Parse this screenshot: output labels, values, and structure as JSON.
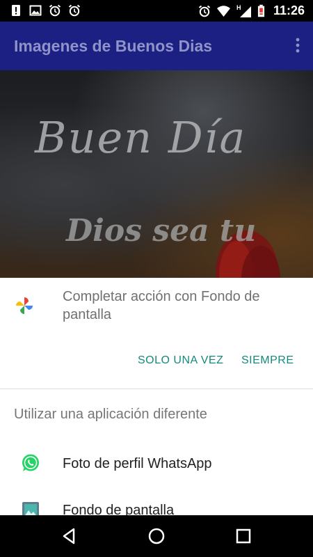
{
  "status_bar": {
    "time": "11:26",
    "left_icons": [
      "alert-icon",
      "image-icon",
      "alarm-icon",
      "alarm-icon"
    ],
    "right_icons": [
      "alarm-icon",
      "wifi-icon",
      "signal-h-icon",
      "battery-icon"
    ],
    "network_letter": "H"
  },
  "app_bar": {
    "title": "Imagenes de Buenos Dias",
    "menu_icon": "more-vert-icon"
  },
  "background": {
    "line1": "Buen Día",
    "line2": "Dios sea tu"
  },
  "sheet": {
    "title": "Completar acción con Fondo de pantalla",
    "title_icon": "google-photos-pinwheel-icon",
    "once_button": "SOLO UNA VEZ",
    "always_button": "SIEMPRE",
    "alt_title": "Utilizar una aplicación diferente",
    "apps": [
      {
        "label": "Foto de perfil WhatsApp",
        "icon": "whatsapp-icon"
      },
      {
        "label": "Fondo de pantalla",
        "icon": "gallery-icon"
      }
    ]
  },
  "colors": {
    "app_bar": "#1b2082",
    "accent": "#13897c",
    "whatsapp": "#25d366"
  },
  "nav_bar": {
    "buttons": [
      "back-icon",
      "home-icon",
      "recent-apps-icon"
    ]
  }
}
